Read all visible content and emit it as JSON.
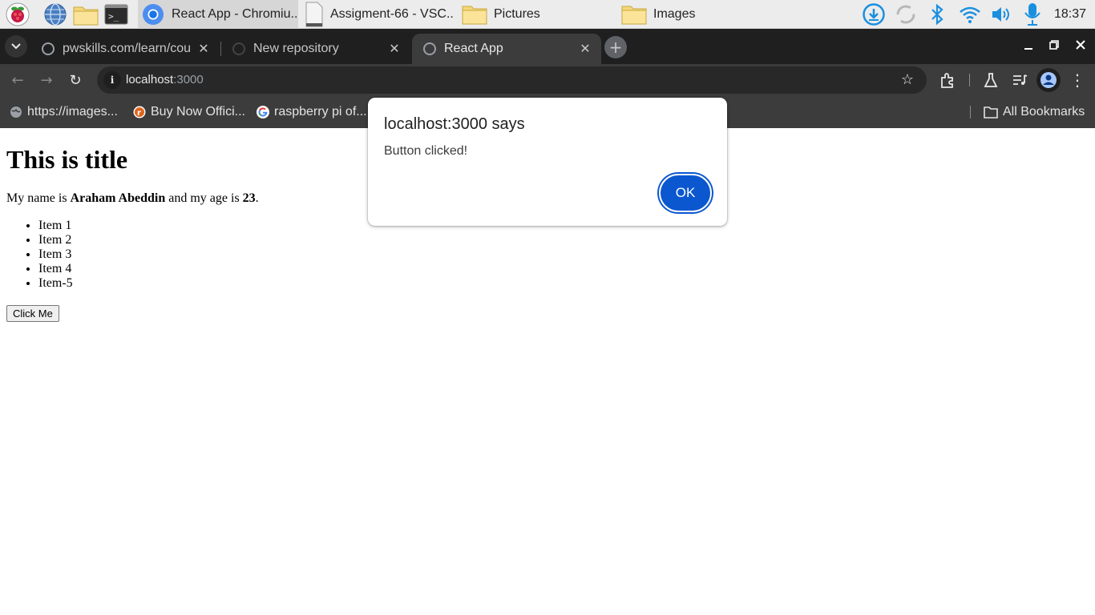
{
  "taskbar": {
    "tasks": [
      {
        "label": "React App - Chromiu..",
        "active": true
      },
      {
        "label": "Assigment-66 - VSC.."
      },
      {
        "label": "Pictures"
      },
      {
        "label": "Images"
      }
    ],
    "clock": "18:37"
  },
  "browser": {
    "tabs": [
      {
        "title": "pwskills.com/learn/cou"
      },
      {
        "title": "New repository"
      },
      {
        "title": "React App",
        "active": true
      }
    ],
    "address": {
      "host": "localhost",
      "port": ":3000"
    },
    "bookmarks": [
      "https://images...",
      "Buy Now Offici...",
      "raspberry pi of..."
    ],
    "all_bookmarks": "All Bookmarks"
  },
  "page": {
    "title": "This is title",
    "intro_prefix": "My name is ",
    "name": "Araham Abeddin",
    "intro_middle": " and my age is ",
    "age": "23",
    "intro_suffix": ".",
    "items": [
      "Item 1",
      "Item 2",
      "Item 3",
      "Item 4",
      "Item-5"
    ],
    "button_label": "Click Me"
  },
  "dialog": {
    "title": "localhost:3000 says",
    "message": "Button clicked!",
    "ok_label": "OK"
  },
  "colors": {
    "accent": "#0b57d0",
    "chrome_dark": "#1f1f1f",
    "chrome_toolbar": "#3c3c3c"
  }
}
